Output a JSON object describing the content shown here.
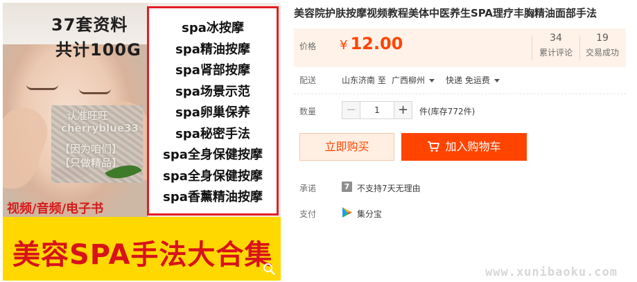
{
  "image": {
    "count_text": "37套资料",
    "size_text": "共计100G",
    "stamp_lines": [
      "认准旺旺",
      "cherryblue33",
      "【因为咱们】",
      "【只做精品】"
    ],
    "media_types": "视频/音频/电子书",
    "list_items": [
      "spa冰按摩",
      "spa精油按摩",
      "spa肾部按摩",
      "spa场景示范",
      "spa卵巢保养",
      "spa秘密手法",
      "spa全身保健按摩",
      "spa全身保健按摩",
      "spa香薰精油按摩"
    ],
    "banner": "美容SPA手法大合集"
  },
  "product": {
    "title": "美容院护肤按摩视频教程美体中医养生SPA理疗丰胸精油面部手法"
  },
  "price": {
    "label": "价格",
    "currency": "¥",
    "value": "12.00",
    "stats": [
      {
        "num": "34",
        "label": "累计评论"
      },
      {
        "num": "19",
        "label": "交易成功"
      }
    ]
  },
  "shipping": {
    "label": "配送",
    "from": "山东济南",
    "to_word": "至",
    "to": "广西柳州",
    "method": "快递 免运费"
  },
  "quantity": {
    "label": "数量",
    "minus": "−",
    "value": "1",
    "plus": "+",
    "unit_stock": "件(库存772件)"
  },
  "actions": {
    "buy_now": "立即购买",
    "add_cart": "加入购物车"
  },
  "promise": {
    "label": "承诺",
    "icon_text": "7",
    "text": "不支持7天无理由"
  },
  "payment": {
    "label": "支付",
    "text": "集分宝"
  },
  "watermark": "www.xunibaoku.com",
  "colors": {
    "accent": "#ff4400",
    "price_bg": "#fff2e8",
    "banner": "#ffd800",
    "banner_text": "#d8121a"
  }
}
